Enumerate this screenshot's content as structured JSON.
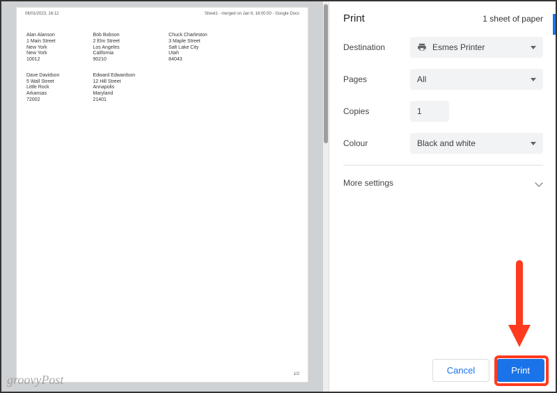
{
  "preview": {
    "timestamp": "06/01/2023, 16:12",
    "title": "Sheet1 - merged on Jan 6, 16:00:50 - Google Docs",
    "page_num": "1/2",
    "columns": [
      [
        {
          "lines": [
            "Alan Alanson",
            "1 Main Street",
            "New York",
            "New York",
            "10012"
          ]
        },
        {
          "lines": [
            "Dave Davidson",
            "5 Wall Street",
            "Little Rock",
            "Arkansas",
            "72002"
          ]
        }
      ],
      [
        {
          "lines": [
            "Bob Bobson",
            "2 Elm Street",
            "Los Angeles",
            "California",
            "90210"
          ]
        },
        {
          "lines": [
            "Edward Edwardson",
            "12 Hill Street",
            "Annapolis",
            "Maryland",
            "21401"
          ]
        }
      ],
      [
        {
          "lines": [
            "Chuck Charleston",
            "3 Maple Street",
            "Salt Lake City",
            "Utah",
            "84043"
          ]
        }
      ]
    ]
  },
  "panel": {
    "title": "Print",
    "sheet_count": "1 sheet of paper",
    "destination_label": "Destination",
    "destination_value": "Esmes Printer",
    "pages_label": "Pages",
    "pages_value": "All",
    "copies_label": "Copies",
    "copies_value": "1",
    "colour_label": "Colour",
    "colour_value": "Black and white",
    "more_settings": "More settings",
    "cancel": "Cancel",
    "print": "Print"
  },
  "watermark": "groovyPost"
}
